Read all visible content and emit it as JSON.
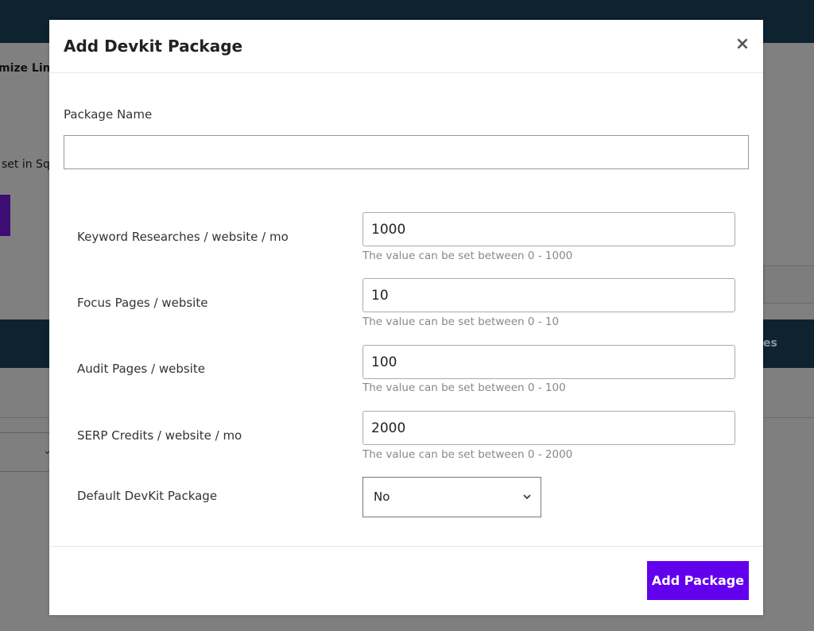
{
  "background": {
    "heading_fragment": "mize Lim",
    "text_fragment": "set in Sq",
    "bar_text_fragment": "es"
  },
  "modal": {
    "title": "Add Devkit Package",
    "close_glyph": "×",
    "package_name_label": "Package Name",
    "package_name_value": "",
    "limits": [
      {
        "label": "Keyword Researches / website / mo",
        "value": "1000",
        "help": "The value can be set between 0 - 1000"
      },
      {
        "label": "Focus Pages / website",
        "value": "10",
        "help": "The value can be set between 0 - 10"
      },
      {
        "label": "Audit Pages / website",
        "value": "100",
        "help": "The value can be set between 0 - 100"
      },
      {
        "label": "SERP Credits / website / mo",
        "value": "2000",
        "help": "The value can be set between 0 - 2000"
      }
    ],
    "default_label": "Default DevKit Package",
    "default_value": "No",
    "submit_label": "Add Package"
  },
  "colors": {
    "accent": "#6200ee",
    "topbar": "#0f2230"
  },
  "icons": {
    "close": "close-icon",
    "select": "chevron-down-icon"
  }
}
